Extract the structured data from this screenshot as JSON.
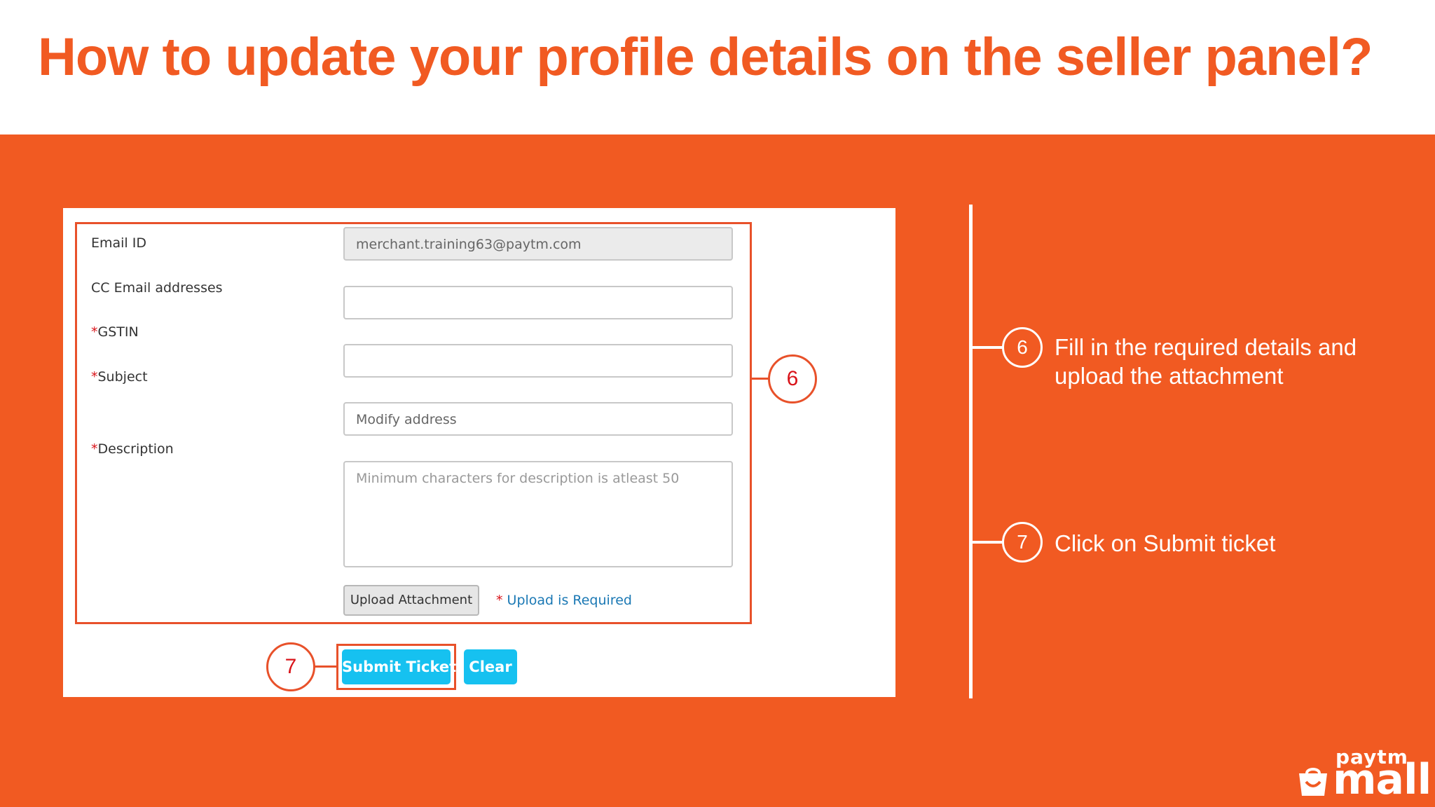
{
  "title": "How to update your profile details on the seller panel?",
  "form": {
    "fields": [
      {
        "label": "Email ID",
        "required": false,
        "value": "merchant.training63@paytm.com",
        "placeholder": "",
        "disabled": true
      },
      {
        "label": "CC Email addresses",
        "required": false,
        "value": "",
        "placeholder": ""
      },
      {
        "label": "GSTIN",
        "required": true,
        "value": "",
        "placeholder": ""
      },
      {
        "label": "Subject",
        "required": true,
        "value": "Modify address",
        "placeholder": ""
      },
      {
        "label": "Description",
        "required": true,
        "value": "",
        "placeholder": "Minimum characters for description is atleast 50"
      }
    ],
    "required_marker": "*",
    "upload_button": "Upload Attachment",
    "upload_required": "Upload is Required",
    "submit_button": "Submit Ticket",
    "clear_button": "Clear"
  },
  "callouts": {
    "form": "6",
    "submit": "7"
  },
  "steps": [
    {
      "number": "6",
      "text": "Fill in the required details and upload the attachment"
    },
    {
      "number": "7",
      "text": "Click on Submit ticket"
    }
  ],
  "logo": {
    "top": "paytm",
    "bottom": "mall"
  },
  "colors": {
    "brand_orange": "#f15a22",
    "button_blue": "#16c1f0",
    "required_red": "#d9141a",
    "link_blue": "#1a78b4"
  }
}
